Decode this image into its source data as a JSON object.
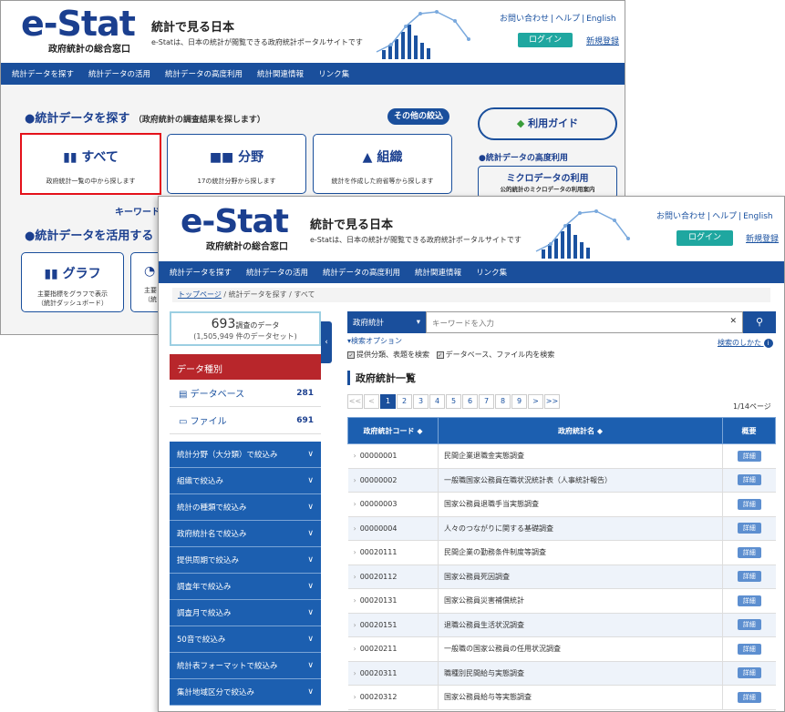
{
  "header": {
    "logo": "e-Stat",
    "logo_sub": "政府統計の総合窓口",
    "tagline": "統計で見る日本",
    "tagline_sub": "e-Statは、日本の統計が閲覧できる政府統計ポータルサイトです",
    "links": [
      "お問い合わせ",
      "ヘルプ",
      "English"
    ],
    "login": "ログイン",
    "register": "新規登録"
  },
  "nav": [
    "統計データを探す",
    "統計データの活用",
    "統計データの高度利用",
    "統計関連情報",
    "リンク集"
  ],
  "home": {
    "find_title": "●統計データを探す",
    "find_sub": "（政府統計の調査結果を探します）",
    "more_filter": "その他の絞込",
    "cards": [
      {
        "title": "すべて",
        "sub": "政府統計一覧の中から探します"
      },
      {
        "title": "分野",
        "sub": "17の統計分野から探します"
      },
      {
        "title": "組織",
        "sub": "統計を作成した府省等から探します"
      }
    ],
    "guide": "利用ガイド",
    "advanced_head": "●統計データの高度利用",
    "micro_title": "ミクロデータの利用",
    "micro_sub": "公的統計のミクロデータの利用案内",
    "keyword": "キーワード",
    "use_title": "●統計データを活用する",
    "graph_title": "グラフ",
    "graph_sub1": "主要指標をグラフで表示",
    "graph_sub2": "（統計ダッシュボード）",
    "partial_sub1": "主要",
    "partial_sub2": "（統"
  },
  "breadcrumb": {
    "home": "トップページ",
    "find": "統計データを探す",
    "current": "すべて"
  },
  "count": {
    "main": "693",
    "main_suffix": "調査のデータ",
    "sub": "(1,505,949 件のデータセット)"
  },
  "data_types": {
    "header": "データ種別",
    "items": [
      {
        "label": "データベース",
        "count": "281"
      },
      {
        "label": "ファイル",
        "count": "691"
      }
    ]
  },
  "filters": [
    "統計分野（大分類）で絞込み",
    "組織で絞込み",
    "統計の種類で絞込み",
    "政府統計名で絞込み",
    "提供周期で絞込み",
    "調査年で絞込み",
    "調査月で絞込み",
    "50音で絞込み",
    "統計表フォーマットで絞込み",
    "集計地域区分で絞込み"
  ],
  "search": {
    "scope": "政府統計",
    "placeholder": "キーワードを入力",
    "options": "▾検索オプション",
    "howto": "検索のしかた",
    "check1": "提供分類、表題を検索",
    "check2": "データベース、ファイル内を検索"
  },
  "list_title": "政府統計一覧",
  "pager": {
    "pages": [
      "1",
      "2",
      "3",
      "4",
      "5",
      "6",
      "7",
      "8",
      "9"
    ],
    "current": "1",
    "info": "1/14ページ"
  },
  "table": {
    "headers": [
      "政府統計コード ◆",
      "政府統計名 ◆",
      "概要"
    ],
    "detail_label": "詳細",
    "rows": [
      {
        "code": "00000001",
        "name": "民間企業退職金実態調査"
      },
      {
        "code": "00000002",
        "name": "一般職国家公務員在職状況統計表（人事統計報告）"
      },
      {
        "code": "00000003",
        "name": "国家公務員退職手当実態調査"
      },
      {
        "code": "00000004",
        "name": "人々のつながりに関する基礎調査"
      },
      {
        "code": "00020111",
        "name": "民間企業の勤務条件制度等調査"
      },
      {
        "code": "00020112",
        "name": "国家公務員死因調査"
      },
      {
        "code": "00020131",
        "name": "国家公務員災害補償統計"
      },
      {
        "code": "00020151",
        "name": "退職公務員生活状況調査"
      },
      {
        "code": "00020211",
        "name": "一般職の国家公務員の任用状況調査"
      },
      {
        "code": "00020311",
        "name": "職種別民間給与実態調査"
      },
      {
        "code": "00020312",
        "name": "国家公務員給与等実態調査"
      }
    ]
  },
  "colors": {
    "brand_blue": "#1a4f9c",
    "red": "#b8262b",
    "login": "#1fa7a0"
  }
}
